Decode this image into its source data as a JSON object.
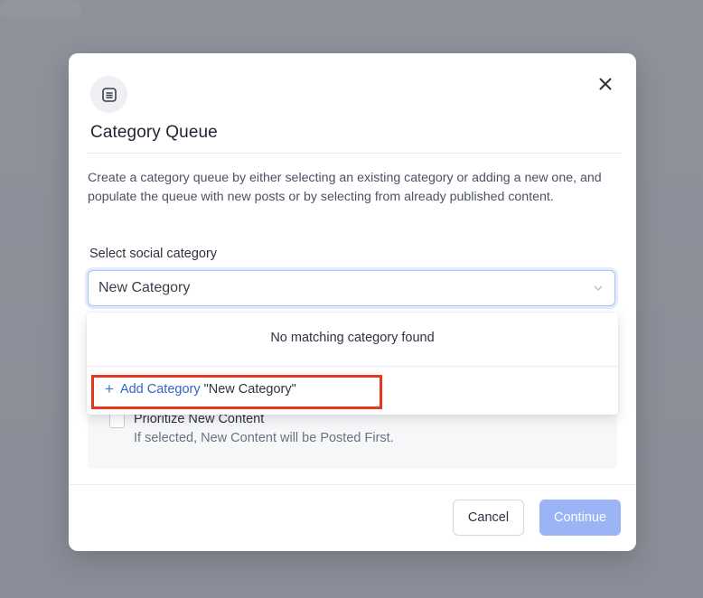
{
  "modal": {
    "title": "Category Queue",
    "description": "Create a category queue by either selecting an existing category or adding a new one, and populate the queue with new posts or by selecting from already published content.",
    "header_icon": "queue-list-icon",
    "close_icon": "close-icon"
  },
  "category_field": {
    "label": "Select social category",
    "value": "New Category"
  },
  "dropdown": {
    "empty_message": "No matching category found",
    "add_link_label": "Add Category",
    "add_query_label": "\"New Category\""
  },
  "prioritize": {
    "label": "Prioritize New Content",
    "help": "If selected, New Content will be Posted First.",
    "checked": false
  },
  "footer": {
    "cancel_label": "Cancel",
    "continue_label": "Continue"
  },
  "colors": {
    "accent": "#3463c9",
    "continue_disabled": "#9bb4f5",
    "highlight": "#e8351f",
    "overlay": "#8d9099"
  }
}
